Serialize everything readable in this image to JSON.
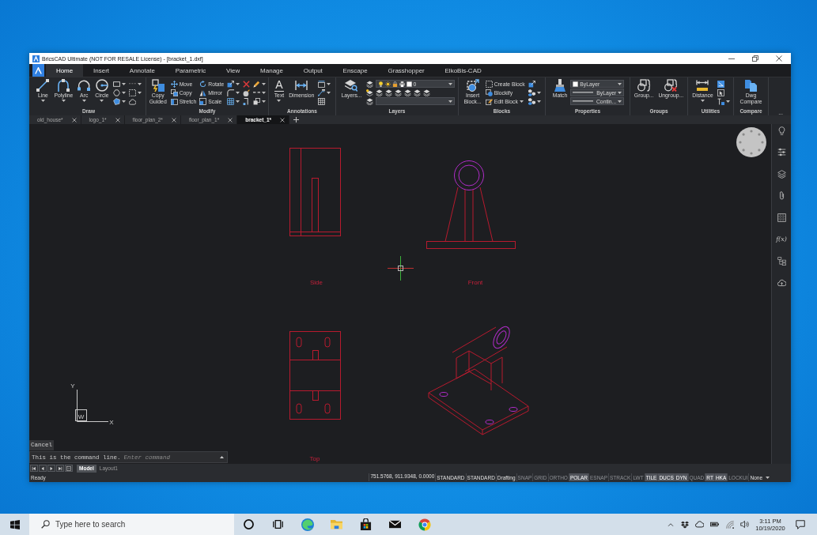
{
  "window": {
    "title": "BricsCAD Ultimate (NOT FOR RESALE License) - [bracket_1.dxf]"
  },
  "ribbon": {
    "tabs": [
      {
        "label": "Home",
        "selected": true
      },
      {
        "label": "Insert",
        "selected": false
      },
      {
        "label": "Annotate",
        "selected": false
      },
      {
        "label": "Parametric",
        "selected": false
      },
      {
        "label": "View",
        "selected": false
      },
      {
        "label": "Manage",
        "selected": false
      },
      {
        "label": "Output",
        "selected": false
      },
      {
        "label": "Enscape",
        "selected": false
      },
      {
        "label": "Grasshopper",
        "selected": false
      },
      {
        "label": "ElkoBis-CAD",
        "selected": false
      }
    ],
    "panels": [
      {
        "title": "Draw",
        "columns": [
          {
            "kind": "large",
            "label": "Line",
            "dropdown": true
          },
          {
            "kind": "large",
            "label": "Polyline",
            "dropdown": true
          },
          {
            "kind": "large",
            "label": "Arc",
            "dropdown": true
          },
          {
            "kind": "large",
            "label": "Circle",
            "dropdown": true
          },
          {
            "kind": "stack",
            "rows": [
              {
                "dropdown": true
              },
              {
                "dropdown": true
              },
              {
                "dropdown": true
              }
            ]
          },
          {
            "kind": "stack",
            "rows": [
              {
                "dropdown": true
              },
              {
                "dropdown": true
              },
              {
                "dropdown": false
              }
            ]
          }
        ]
      },
      {
        "title": "Modify",
        "columns": [
          {
            "kind": "large",
            "label": "Copy Guided",
            "dropdown": false
          },
          {
            "kind": "stack",
            "rows": [
              {
                "label": "Move",
                "dropdown": false
              },
              {
                "label": "Copy",
                "dropdown": false
              },
              {
                "label": "Stretch",
                "dropdown": false
              }
            ]
          },
          {
            "kind": "stack",
            "rows": [
              {
                "label": "Rotate",
                "dropdown": false
              },
              {
                "label": "Mirror",
                "dropdown": false
              },
              {
                "label": "Scale",
                "dropdown": false
              }
            ]
          },
          {
            "kind": "stack",
            "rows": [
              {
                "dropdown": true
              },
              {
                "dropdown": true
              },
              {
                "dropdown": true
              }
            ]
          },
          {
            "kind": "stack",
            "rows": [
              {
                "dropdown": false
              },
              {
                "dropdown": false
              },
              {
                "dropdown": false
              }
            ]
          },
          {
            "kind": "stack",
            "rows": [
              {
                "dropdown": true
              },
              {
                "dropdown": true
              },
              {
                "dropdown": true
              }
            ]
          }
        ]
      },
      {
        "title": "Annotations",
        "columns": [
          {
            "kind": "large",
            "label": "Text",
            "glyph": "A",
            "dropdown": true
          },
          {
            "kind": "large",
            "label": "Dimension",
            "dropdown": false
          },
          {
            "kind": "stack",
            "rows": [
              {
                "dropdown": true
              },
              {
                "dropdown": true
              },
              {
                "dropdown": false
              }
            ]
          }
        ]
      },
      {
        "title": "Layers",
        "columns": [
          {
            "kind": "large",
            "label": "Layers...",
            "dropdown": false
          },
          {
            "kind": "stack",
            "rows": [
              {
                "dropdown": false
              },
              {
                "dropdown": false
              },
              {
                "dropdown": false
              }
            ]
          },
          {
            "kind": "combos",
            "rows": [
              {
                "kind": "layer_combo",
                "value": "0"
              },
              {
                "kind": "icon_row"
              },
              {
                "kind": "combo"
              }
            ]
          }
        ]
      },
      {
        "title": "Blocks",
        "columns": [
          {
            "kind": "large",
            "label": "Insert Block...",
            "dropdown": false
          },
          {
            "kind": "stack",
            "rows": [
              {
                "label": "Create Block",
                "dropdown": false
              },
              {
                "label": "Blockify",
                "dropdown": false
              },
              {
                "label": "Edit Block",
                "dropdown": true
              }
            ]
          },
          {
            "kind": "stack",
            "rows": [
              {
                "dropdown": false
              },
              {
                "dropdown": true
              },
              {
                "dropdown": true
              }
            ]
          }
        ]
      },
      {
        "title": "Properties",
        "columns": [
          {
            "kind": "large",
            "label": "Match",
            "dropdown": false
          },
          {
            "kind": "combos",
            "rows": [
              {
                "kind": "color_combo",
                "value": "ByLayer"
              },
              {
                "kind": "line_combo",
                "value": "ByLayer"
              },
              {
                "kind": "line_combo",
                "value": "Contin..."
              }
            ]
          }
        ]
      },
      {
        "title": "Groups",
        "columns": [
          {
            "kind": "large",
            "label": "Group...",
            "dropdown": false
          },
          {
            "kind": "large",
            "label": "Ungroup...",
            "dropdown": false
          }
        ]
      },
      {
        "title": "Utilities",
        "columns": [
          {
            "kind": "large",
            "label": "Distance",
            "dropdown": true
          },
          {
            "kind": "stack",
            "rows": [
              {
                "dropdown": false
              },
              {
                "dropdown": false
              },
              {
                "dropdown": true
              }
            ]
          }
        ]
      },
      {
        "title": "Compare",
        "columns": [
          {
            "kind": "large",
            "label": "Dwg Compare",
            "dropdown": false
          }
        ]
      }
    ],
    "overflow": "..."
  },
  "doc_tabs": [
    {
      "label": "old_house*",
      "selected": false
    },
    {
      "label": "logo_1*",
      "selected": false
    },
    {
      "label": "floor_plan_2*",
      "selected": false
    },
    {
      "label": "floor_plan_1*",
      "selected": false
    },
    {
      "label": "bracket_1*",
      "selected": true
    }
  ],
  "canvas": {
    "view_labels": [
      "Side",
      "Front",
      "Top"
    ],
    "axis_labels": {
      "y": "Y",
      "x": "X",
      "origin": "W"
    }
  },
  "side_panel": {
    "function_glyph": "f(x)"
  },
  "command_line": {
    "history": "Cancel",
    "prompt": "This is the command line.",
    "placeholder": "Enter command"
  },
  "layout_tabs": [
    {
      "label": "Model",
      "selected": true
    },
    {
      "label": "Layout1",
      "selected": false
    }
  ],
  "status_bar": {
    "message": "Ready",
    "coordinates": "751.5768, 911.9348, 0.0000",
    "fields": [
      "STANDARD",
      "STANDARD",
      "Drafting"
    ],
    "toggles": [
      {
        "label": "SNAP",
        "on": false
      },
      {
        "label": "GRID",
        "on": false
      },
      {
        "label": "ORTHO",
        "on": false
      },
      {
        "label": "POLAR",
        "on": true
      },
      {
        "label": "ESNAP",
        "on": false
      },
      {
        "label": "STRACK",
        "on": false
      },
      {
        "label": "LWT",
        "on": false
      },
      {
        "label": "TILE",
        "on": true
      },
      {
        "label": "DUCS",
        "on": true
      },
      {
        "label": "DYN",
        "on": true
      },
      {
        "label": "QUAD",
        "on": false
      },
      {
        "label": "RT",
        "on": true
      },
      {
        "label": "HKA",
        "on": true
      },
      {
        "label": "LOCKUI",
        "on": false
      }
    ],
    "snap_mode": "None"
  },
  "taskbar": {
    "search_placeholder": "Type here to search",
    "time": "3:11 PM",
    "date": "10/19/2020"
  }
}
